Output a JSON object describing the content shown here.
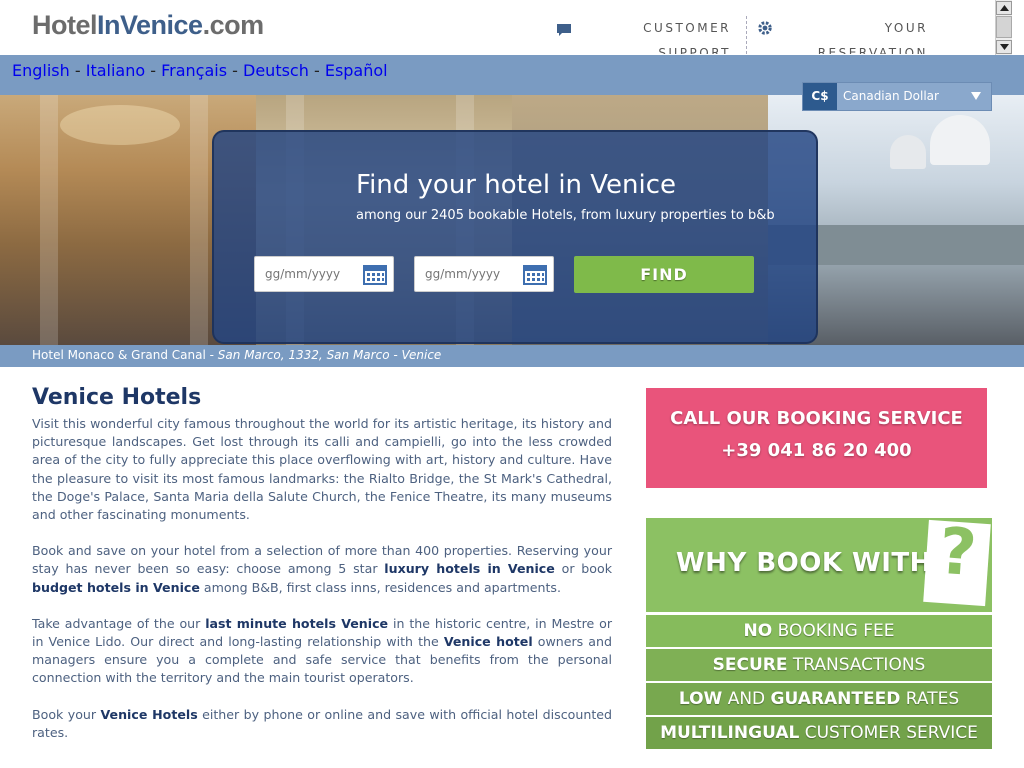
{
  "header": {
    "logo": {
      "part1": "Hotel",
      "part2": "InVenice",
      "part3": ".com"
    },
    "customer_support": "CUSTOMER SUPPORT",
    "your_reservation": "YOUR RESERVATION"
  },
  "languages": [
    {
      "label": "English"
    },
    {
      "label": "Italiano"
    },
    {
      "label": "Français"
    },
    {
      "label": "Deutsch"
    },
    {
      "label": "Español"
    }
  ],
  "currency": {
    "symbol": "C$",
    "name": "Canadian Dollar"
  },
  "search": {
    "title": "Find your hotel in Venice",
    "subtitle": "among our 2405 bookable Hotels, from luxury properties to b&b",
    "checkin_placeholder": "gg/mm/yyyy",
    "checkout_placeholder": "gg/mm/yyyy",
    "find_label": "FIND"
  },
  "caption": {
    "hotel": "Hotel Monaco & Grand Canal - ",
    "address": "San Marco, 1332, San Marco - Venice"
  },
  "main": {
    "title": "Venice Hotels",
    "p1": "Visit this wonderful city famous throughout the world for its artistic heritage, its history and picturesque landscapes. Get lost through its calli and campielli, go into the less crowded area of the city to fully appreciate this place overflowing with art, history and culture. Have the pleasure to visit its most famous landmarks: the Rialto Bridge, the St Mark's Cathedral, the Doge's Palace, Santa Maria della Salute Church, the Fenice Theatre, its many museums and other fascinating monuments.",
    "p2_a": "Book and save on your hotel from a selection of more than 400 properties. Reserving your stay has never been so easy: choose among 5 star ",
    "p2_link1": "luxury hotels in Venice",
    "p2_b": " or book ",
    "p2_link2": "budget hotels in Venice",
    "p2_c": " among B&B, first class inns, residences and apartments.",
    "p3_a": "Take advantage of the our ",
    "p3_link1": "last minute hotels Venice",
    "p3_b": " in the historic centre, in Mestre or in Venice Lido. Our direct and long-lasting relationship with the ",
    "p3_link2": "Venice hotel",
    "p3_c": " owners and managers ensure you a complete and safe service that benefits from the personal connection with the territory and the main tourist operators.",
    "p4_a": "Book your ",
    "p4_link": "Venice Hotels",
    "p4_b": " either by phone or online and save with official hotel discounted rates."
  },
  "call": {
    "label": "CALL OUR BOOKING SERVICE",
    "phone": "+39 041 86 20 400"
  },
  "why": {
    "title": "WHY BOOK WITH US",
    "rows": [
      {
        "bold": "NO",
        "rest": " BOOKING FEE"
      },
      {
        "bold": "SECURE",
        "rest": " TRANSACTIONS"
      },
      {
        "bold": "LOW",
        "mid": " AND ",
        "bold2": "GUARANTEED",
        "rest": " RATES"
      },
      {
        "bold": "MULTILINGUAL",
        "rest": " CUSTOMER SERVICE"
      }
    ]
  },
  "colors": {
    "accent_blue": "#7a9bc2",
    "pink": "#e9547b",
    "green": "#8cc163",
    "find_green": "#7fba4a"
  }
}
